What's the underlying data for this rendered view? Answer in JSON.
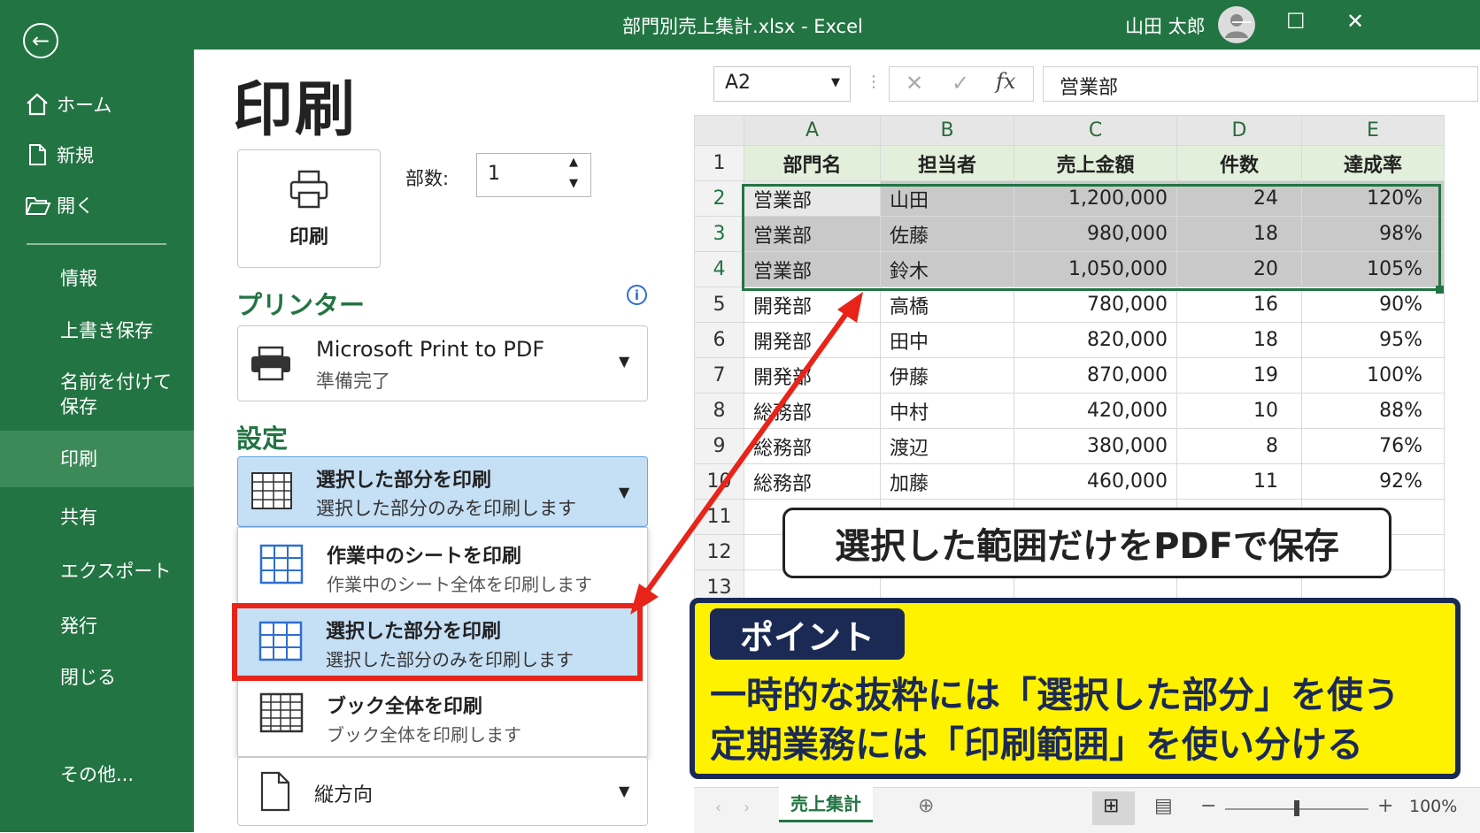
{
  "window": {
    "title": "部門別売上集計.xlsx  -  Excel",
    "user": "山田 太郎",
    "min": "—",
    "max": "☐",
    "close": "✕"
  },
  "sidebar": {
    "back": "←",
    "items": [
      {
        "label": "ホーム",
        "icon": "home-icon"
      },
      {
        "label": "新規",
        "icon": "new-document-icon"
      },
      {
        "label": "開く",
        "icon": "folder-open-icon"
      }
    ],
    "sub_items": [
      "情報",
      "上書き保存",
      "名前を付けて\n保存",
      "印刷",
      "共有",
      "エクスポート",
      "発行",
      "閉じる",
      "その他..."
    ],
    "active": "印刷"
  },
  "print_panel": {
    "title": "印刷",
    "print_button": "印刷",
    "copies_label": "部数:",
    "copies_value": "1",
    "printer_section": "プリンター",
    "printer_name": "Microsoft Print to PDF",
    "printer_status": "準備完了",
    "settings_section": "設定",
    "selected_setting": {
      "title": "選択した部分を印刷",
      "desc": "選択した部分のみを印刷します"
    },
    "options": [
      {
        "title": "作業中のシートを印刷",
        "desc": "作業中のシート全体を印刷します"
      },
      {
        "title": "選択した部分を印刷",
        "desc": "選択した部分のみを印刷します"
      },
      {
        "title": "ブック全体を印刷",
        "desc": "ブック全体を印刷します"
      }
    ],
    "orientation": "縦方向"
  },
  "formula_bar": {
    "name_box": "A2",
    "fx": "fx",
    "cancel": "✕",
    "enter": "✓",
    "content": "営業部"
  },
  "sheet": {
    "columns": [
      "A",
      "B",
      "C",
      "D",
      "E"
    ],
    "header_row": [
      "部門名",
      "担当者",
      "売上金額",
      "件数",
      "達成率"
    ],
    "rows": [
      [
        "営業部",
        "山田",
        "1,200,000",
        "24",
        "120%"
      ],
      [
        "営業部",
        "佐藤",
        "980,000",
        "18",
        "98%"
      ],
      [
        "営業部",
        "鈴木",
        "1,050,000",
        "20",
        "105%"
      ],
      [
        "開発部",
        "高橋",
        "780,000",
        "16",
        "90%"
      ],
      [
        "開発部",
        "田中",
        "820,000",
        "18",
        "95%"
      ],
      [
        "開発部",
        "伊藤",
        "870,000",
        "19",
        "100%"
      ],
      [
        "総務部",
        "中村",
        "420,000",
        "10",
        "88%"
      ],
      [
        "総務部",
        "渡辺",
        "380,000",
        "8",
        "76%"
      ],
      [
        "総務部",
        "加藤",
        "460,000",
        "11",
        "92%"
      ]
    ],
    "row_numbers": [
      "1",
      "2",
      "3",
      "4",
      "5",
      "6",
      "7",
      "8",
      "9",
      "10",
      "11",
      "12",
      "13"
    ],
    "sheet_tab": "売上集計",
    "zoom": "100%"
  },
  "annotations": {
    "callout": "選択した範囲だけをPDFで保存",
    "point_label": "ポイント",
    "point_line1": "一時的な抜粋には「選択した部分」を使う",
    "point_line2": "定期業務には「印刷範囲」を使い分ける",
    "arrow_color": "#e8241a"
  }
}
